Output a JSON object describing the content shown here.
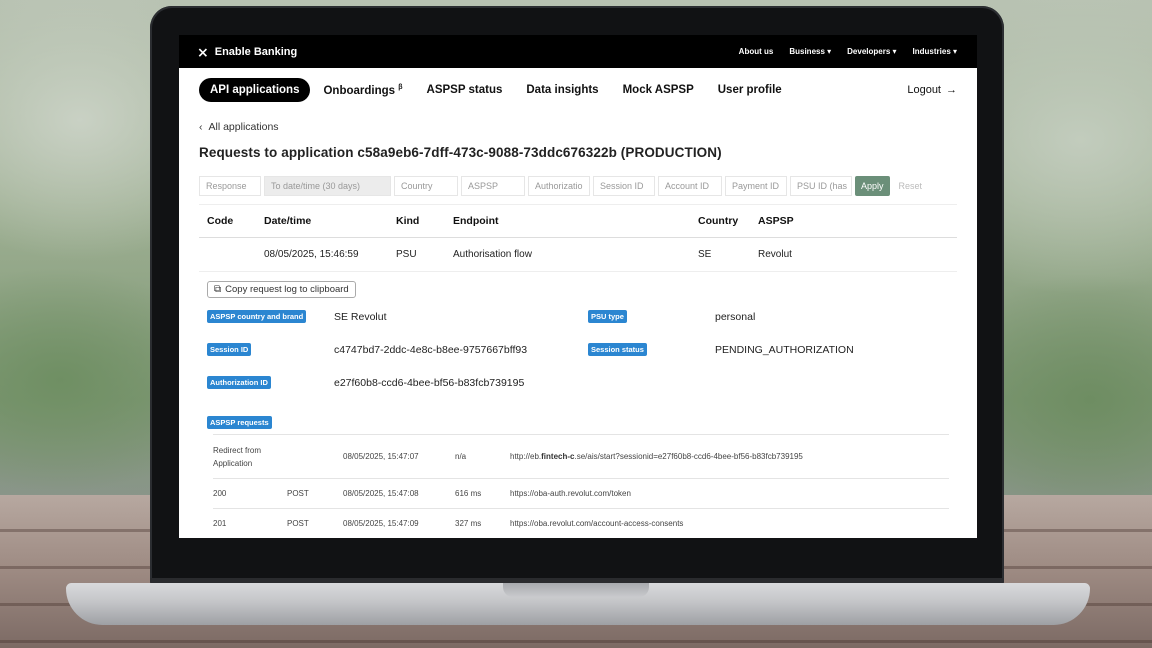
{
  "topbar": {
    "brand": "Enable Banking",
    "brand_icon": "x-logo-icon",
    "nav": [
      "About us",
      "Business ▾",
      "Developers ▾",
      "Industries ▾"
    ]
  },
  "tabs": [
    {
      "label": "API applications",
      "active": true
    },
    {
      "label": "Onboardings",
      "sup": "β",
      "active": false
    },
    {
      "label": "ASPSP status",
      "active": false
    },
    {
      "label": "Data insights",
      "active": false
    },
    {
      "label": "Mock ASPSP",
      "active": false
    },
    {
      "label": "User profile",
      "active": false
    }
  ],
  "logout": {
    "label": "Logout",
    "icon": "→"
  },
  "back": {
    "icon": "‹",
    "label": "All applications"
  },
  "page_title": "Requests to application c58a9eb6-7dff-473c-9088-73ddc676322b (PRODUCTION)",
  "filters": {
    "response": "Response",
    "datetime": "To date/time (30 days)",
    "country": "Country",
    "aspsp": "ASPSP",
    "authorization": "Authorizatio",
    "session_id": "Session ID",
    "account_id": "Account ID",
    "payment_id": "Payment ID",
    "psu_id": "PSU ID (has",
    "apply": "Apply",
    "reset": "Reset"
  },
  "table": {
    "headers": [
      "Code",
      "Date/time",
      "Kind",
      "Endpoint",
      "Country",
      "ASPSP"
    ],
    "rows": [
      [
        "",
        "08/05/2025, 15:46:59",
        "PSU",
        "Authorisation flow",
        "SE",
        "Revolut"
      ]
    ]
  },
  "copy_button": {
    "icon": "clipboard-icon",
    "label": "Copy request log to clipboard"
  },
  "details": {
    "aspsp_country_brand": {
      "label": "ASPSP country and brand",
      "value": "SE Revolut"
    },
    "psu_type": {
      "label": "PSU type",
      "value": "personal"
    },
    "session_id": {
      "label": "Session ID",
      "value": "c4747bd7-2ddc-4e8c-b8ee-9757667bff93"
    },
    "session_status": {
      "label": "Session status",
      "value": "PENDING_AUTHORIZATION"
    },
    "authorization_id": {
      "label": "Authorization ID",
      "value": "e27f60b8-ccd6-4bee-bf56-b83fcb739195"
    }
  },
  "aspsp_requests": {
    "label": "ASPSP requests",
    "rows": [
      {
        "code": "Redirect from Application",
        "method": "",
        "datetime": "08/05/2025, 15:47:07",
        "duration": "n/a",
        "url_pre": "http://eb.",
        "url_bold": "fintech-c",
        "url_post": ".se/ais/start?sessionid=e27f60b8-ccd6-4bee-bf56-b83fcb739195"
      },
      {
        "code": "200",
        "method": "POST",
        "datetime": "08/05/2025, 15:47:08",
        "duration": "616 ms",
        "url_pre": "https://oba-auth.revolut.com/token",
        "url_bold": "",
        "url_post": ""
      },
      {
        "code": "201",
        "method": "POST",
        "datetime": "08/05/2025, 15:47:09",
        "duration": "327 ms",
        "url_pre": "https://oba.revolut.com/account-access-consents",
        "url_bold": "",
        "url_post": ""
      }
    ]
  },
  "colors": {
    "badge_blue": "#2b86d1",
    "apply_green": "#6b8f79",
    "topbar_black": "#000000"
  }
}
